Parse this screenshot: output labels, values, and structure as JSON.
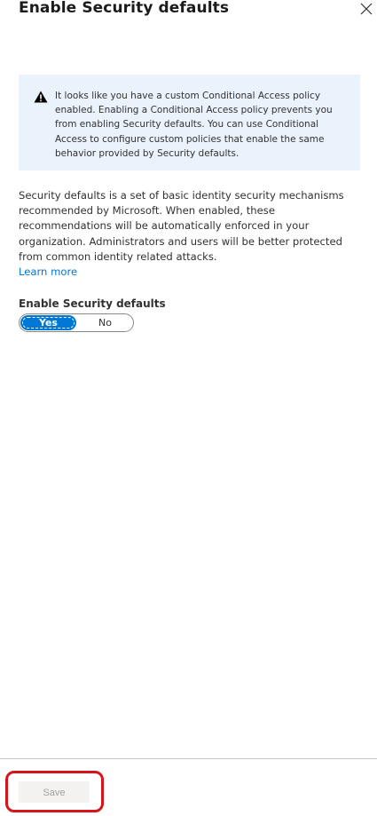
{
  "panel": {
    "title": "Enable Security defaults",
    "close_icon": "close-icon"
  },
  "info_box": {
    "icon": "warning-icon",
    "text": "It looks like you have a custom Conditional Access policy enabled. Enabling a Conditional Access policy prevents you from enabling Security defaults. You can use Conditional Access to configure custom policies that enable the same behavior provided by Security defaults."
  },
  "description": {
    "text": "Security defaults is a set of basic identity security mechanisms recommended by Microsoft. When enabled, these recommendations will be automatically enforced in your organization. Administrators and users will be better protected from common identity related attacks.",
    "learn_more": "Learn more"
  },
  "toggle": {
    "label": "Enable Security defaults",
    "yes_label": "Yes",
    "no_label": "No",
    "selected": "Yes"
  },
  "footer": {
    "save_label": "Save",
    "save_disabled": true
  },
  "colors": {
    "accent": "#0078d4",
    "info_background": "#eaf3fc",
    "highlight": "#d6141b"
  }
}
